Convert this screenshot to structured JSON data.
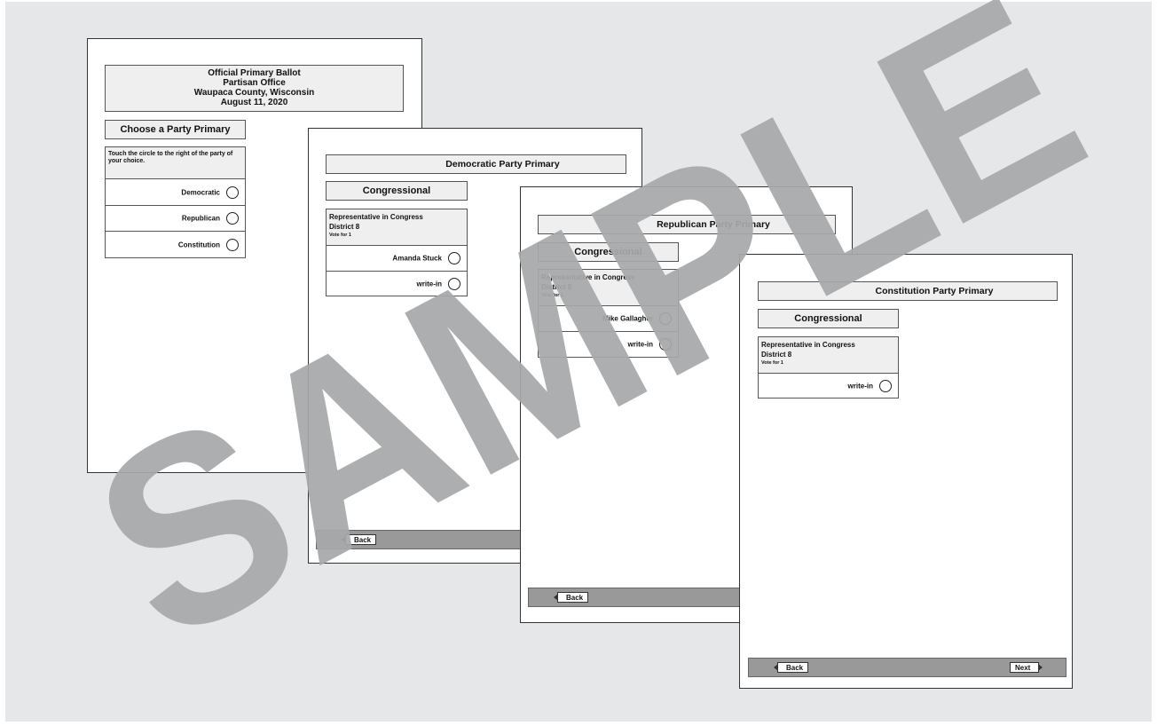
{
  "page1": {
    "header_lines": [
      "Official Primary Ballot",
      "Partisan Office",
      "Waupaca County, Wisconsin",
      "August 11, 2020"
    ],
    "section_title": "Choose a Party Primary",
    "instruction": "Touch the circle to the right of the party of your choice.",
    "choices": [
      "Democratic",
      "Republican",
      "Constitution"
    ]
  },
  "page2": {
    "party_title": "Democratic Party Primary",
    "category": "Congressional",
    "office": "Representative in Congress",
    "district": "District 8",
    "vote_for": "Vote for 1",
    "choices": [
      "Amanda Stuck",
      "write-in"
    ],
    "back_label": "Back"
  },
  "page3": {
    "party_title": "Republican Party Primary",
    "category": "Congressional",
    "office": "Representative in Congress",
    "district": "District 8",
    "vote_for": "Vote for 1",
    "choices": [
      "Mike Gallagher",
      "write-in"
    ],
    "back_label": "Back"
  },
  "page4": {
    "party_title": "Constitution Party Primary",
    "category": "Congressional",
    "office": "Representative in Congress",
    "district": "District 8",
    "vote_for": "Vote for 1",
    "choices": [
      "write-in"
    ],
    "back_label": "Back",
    "next_label": "Next"
  },
  "watermark": "SAMPLE",
  "colors": {
    "background": "#e6e7e8",
    "box_fill": "#efefef",
    "footer": "#999999",
    "watermark": "#a6a8aa"
  }
}
